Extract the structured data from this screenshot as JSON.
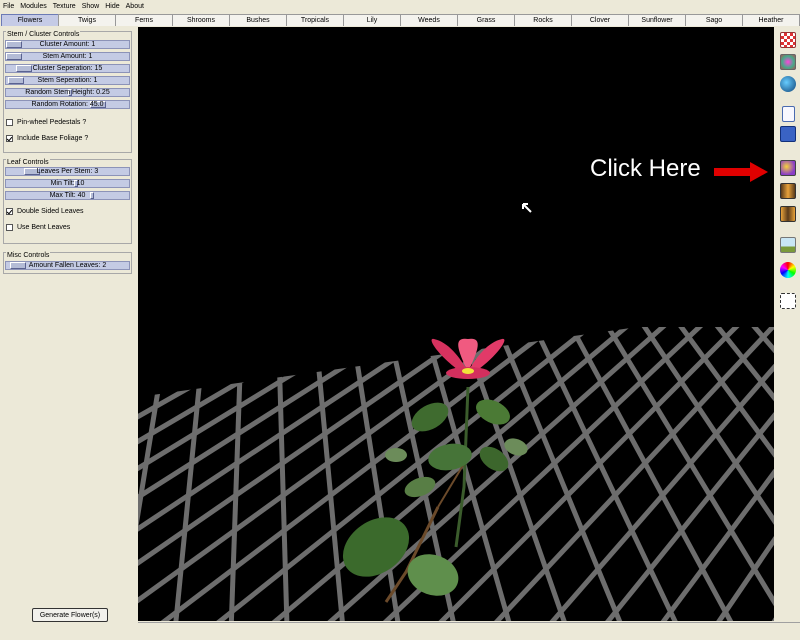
{
  "menu": [
    "File",
    "Modules",
    "Texture",
    "Show",
    "Hide",
    "About"
  ],
  "tabs": [
    "Flowers",
    "Twigs",
    "Ferns",
    "Shrooms",
    "Bushes",
    "Tropicals",
    "Lily",
    "Weeds",
    "Grass",
    "Rocks",
    "Clover",
    "Sunflower",
    "Sago",
    "Heather"
  ],
  "active_tab": "Flowers",
  "stem_controls": {
    "title": "Stem / Cluster Controls",
    "sliders": [
      {
        "label": "Cluster Amount: 1",
        "value": 1
      },
      {
        "label": "Stem Amount: 1",
        "value": 1
      },
      {
        "label": "Cluster Seperation: 15",
        "value": 15
      },
      {
        "label": "Stem Seperation: 1",
        "value": 1
      },
      {
        "label": "Random Stem Height: 0.25",
        "value": 0.25
      },
      {
        "label": "Random Rotation: 45.0",
        "value": 45.0
      }
    ],
    "checkboxes": [
      {
        "label": "Pin-wheel Pedestals ?",
        "checked": false
      },
      {
        "label": "Include Base Foliage ?",
        "checked": true
      }
    ]
  },
  "leaf_controls": {
    "title": "Leaf Controls",
    "sliders": [
      {
        "label": "Leaves Per Stem: 3",
        "value": 3
      },
      {
        "label": "Min Tilt: 10",
        "value": 10
      },
      {
        "label": "Max Tilt: 40",
        "value": 40
      }
    ],
    "checkboxes": [
      {
        "label": "Double Sided Leaves",
        "checked": true
      },
      {
        "label": "Use Bent Leaves",
        "checked": false
      }
    ]
  },
  "misc_controls": {
    "title": "Misc Controls",
    "sliders": [
      {
        "label": "Amount Fallen Leaves: 2",
        "value": 2
      }
    ]
  },
  "generate_button": "Generate Flower(s)",
  "callout": "Click Here",
  "toolbar_icons": [
    "checker-texture-icon",
    "bark-texture-icon",
    "water-drop-icon",
    "new-document-icon",
    "save-disk-icon",
    "flower-model-icon",
    "export-left-icon",
    "export-right-icon",
    "terrain-icon",
    "color-wheel-icon",
    "selection-rect-icon"
  ],
  "colors": {
    "viewport_bg": "#000000",
    "grid": "#7a7a7a",
    "petal": "#e23a68",
    "leaf": "#3f6b2f",
    "callout_arrow": "#e00000"
  }
}
